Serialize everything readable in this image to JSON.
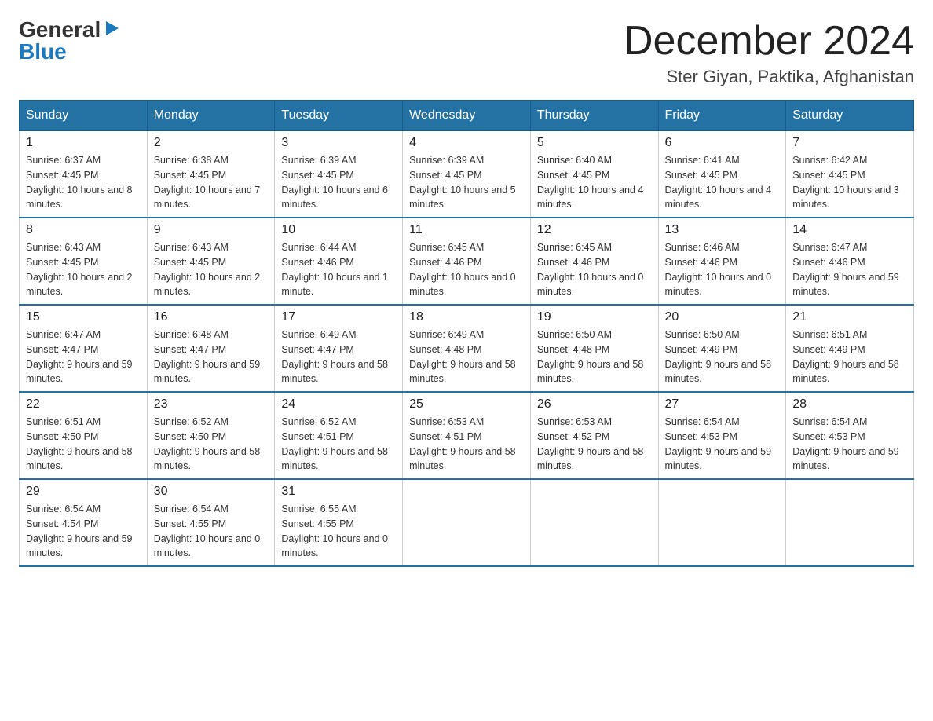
{
  "logo": {
    "general": "General",
    "triangle": "▶",
    "blue": "Blue"
  },
  "title": {
    "month_year": "December 2024",
    "location": "Ster Giyan, Paktika, Afghanistan"
  },
  "days_of_week": [
    "Sunday",
    "Monday",
    "Tuesday",
    "Wednesday",
    "Thursday",
    "Friday",
    "Saturday"
  ],
  "weeks": [
    [
      {
        "day": "1",
        "sunrise": "6:37 AM",
        "sunset": "4:45 PM",
        "daylight": "10 hours and 8 minutes."
      },
      {
        "day": "2",
        "sunrise": "6:38 AM",
        "sunset": "4:45 PM",
        "daylight": "10 hours and 7 minutes."
      },
      {
        "day": "3",
        "sunrise": "6:39 AM",
        "sunset": "4:45 PM",
        "daylight": "10 hours and 6 minutes."
      },
      {
        "day": "4",
        "sunrise": "6:39 AM",
        "sunset": "4:45 PM",
        "daylight": "10 hours and 5 minutes."
      },
      {
        "day": "5",
        "sunrise": "6:40 AM",
        "sunset": "4:45 PM",
        "daylight": "10 hours and 4 minutes."
      },
      {
        "day": "6",
        "sunrise": "6:41 AM",
        "sunset": "4:45 PM",
        "daylight": "10 hours and 4 minutes."
      },
      {
        "day": "7",
        "sunrise": "6:42 AM",
        "sunset": "4:45 PM",
        "daylight": "10 hours and 3 minutes."
      }
    ],
    [
      {
        "day": "8",
        "sunrise": "6:43 AM",
        "sunset": "4:45 PM",
        "daylight": "10 hours and 2 minutes."
      },
      {
        "day": "9",
        "sunrise": "6:43 AM",
        "sunset": "4:45 PM",
        "daylight": "10 hours and 2 minutes."
      },
      {
        "day": "10",
        "sunrise": "6:44 AM",
        "sunset": "4:46 PM",
        "daylight": "10 hours and 1 minute."
      },
      {
        "day": "11",
        "sunrise": "6:45 AM",
        "sunset": "4:46 PM",
        "daylight": "10 hours and 0 minutes."
      },
      {
        "day": "12",
        "sunrise": "6:45 AM",
        "sunset": "4:46 PM",
        "daylight": "10 hours and 0 minutes."
      },
      {
        "day": "13",
        "sunrise": "6:46 AM",
        "sunset": "4:46 PM",
        "daylight": "10 hours and 0 minutes."
      },
      {
        "day": "14",
        "sunrise": "6:47 AM",
        "sunset": "4:46 PM",
        "daylight": "9 hours and 59 minutes."
      }
    ],
    [
      {
        "day": "15",
        "sunrise": "6:47 AM",
        "sunset": "4:47 PM",
        "daylight": "9 hours and 59 minutes."
      },
      {
        "day": "16",
        "sunrise": "6:48 AM",
        "sunset": "4:47 PM",
        "daylight": "9 hours and 59 minutes."
      },
      {
        "day": "17",
        "sunrise": "6:49 AM",
        "sunset": "4:47 PM",
        "daylight": "9 hours and 58 minutes."
      },
      {
        "day": "18",
        "sunrise": "6:49 AM",
        "sunset": "4:48 PM",
        "daylight": "9 hours and 58 minutes."
      },
      {
        "day": "19",
        "sunrise": "6:50 AM",
        "sunset": "4:48 PM",
        "daylight": "9 hours and 58 minutes."
      },
      {
        "day": "20",
        "sunrise": "6:50 AM",
        "sunset": "4:49 PM",
        "daylight": "9 hours and 58 minutes."
      },
      {
        "day": "21",
        "sunrise": "6:51 AM",
        "sunset": "4:49 PM",
        "daylight": "9 hours and 58 minutes."
      }
    ],
    [
      {
        "day": "22",
        "sunrise": "6:51 AM",
        "sunset": "4:50 PM",
        "daylight": "9 hours and 58 minutes."
      },
      {
        "day": "23",
        "sunrise": "6:52 AM",
        "sunset": "4:50 PM",
        "daylight": "9 hours and 58 minutes."
      },
      {
        "day": "24",
        "sunrise": "6:52 AM",
        "sunset": "4:51 PM",
        "daylight": "9 hours and 58 minutes."
      },
      {
        "day": "25",
        "sunrise": "6:53 AM",
        "sunset": "4:51 PM",
        "daylight": "9 hours and 58 minutes."
      },
      {
        "day": "26",
        "sunrise": "6:53 AM",
        "sunset": "4:52 PM",
        "daylight": "9 hours and 58 minutes."
      },
      {
        "day": "27",
        "sunrise": "6:54 AM",
        "sunset": "4:53 PM",
        "daylight": "9 hours and 59 minutes."
      },
      {
        "day": "28",
        "sunrise": "6:54 AM",
        "sunset": "4:53 PM",
        "daylight": "9 hours and 59 minutes."
      }
    ],
    [
      {
        "day": "29",
        "sunrise": "6:54 AM",
        "sunset": "4:54 PM",
        "daylight": "9 hours and 59 minutes."
      },
      {
        "day": "30",
        "sunrise": "6:54 AM",
        "sunset": "4:55 PM",
        "daylight": "10 hours and 0 minutes."
      },
      {
        "day": "31",
        "sunrise": "6:55 AM",
        "sunset": "4:55 PM",
        "daylight": "10 hours and 0 minutes."
      },
      null,
      null,
      null,
      null
    ]
  ]
}
